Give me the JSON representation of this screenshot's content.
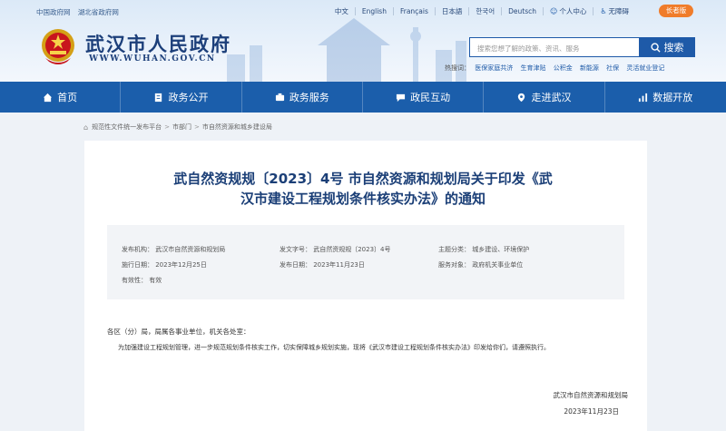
{
  "top": {
    "links": [
      "中国政府网",
      "湖北省政府网"
    ],
    "languages": [
      "中文",
      "English",
      "Français",
      "日本語",
      "한국어",
      "Deutsch"
    ],
    "personal": "个人中心",
    "accessible": "无障碍",
    "elder": "长者版"
  },
  "logo": {
    "title": "武汉市人民政府",
    "url": "WWW.WUHAN.GOV.CN"
  },
  "search": {
    "placeholder": "搜索您想了解的政策、资讯、服务",
    "button": "搜索",
    "hot_label": "热搜词：",
    "hot": [
      "医保家庭共济",
      "生育津贴",
      "公积金",
      "新能源",
      "社保",
      "灵活就业登记"
    ]
  },
  "nav": [
    {
      "label": "首页",
      "icon": "home-icon"
    },
    {
      "label": "政务公开",
      "icon": "doc-icon"
    },
    {
      "label": "政务服务",
      "icon": "service-icon"
    },
    {
      "label": "政民互动",
      "icon": "chat-icon"
    },
    {
      "label": "走进武汉",
      "icon": "location-icon"
    },
    {
      "label": "数据开放",
      "icon": "chart-icon"
    }
  ],
  "breadcrumb": [
    "规范性文件统一发布平台",
    "市部门",
    "市自然资源和城乡建设局"
  ],
  "doc": {
    "title_line1": "武自然资规规〔2023〕4号 市自然资源和规划局关于印发《武",
    "title_line2": "汉市建设工程规划条件核实办法》的通知",
    "meta": {
      "issuer": "发布机构：  武汉市自然资源和规划局",
      "doc_no": "发文字号：  武自然资规规〔2023〕4号",
      "category": "主题分类：  城乡建设、环境保护",
      "impl_date": "施行日期：  2023年12月25日",
      "pub_date": "发布日期：  2023年11月23日",
      "audience": "服务对象：  政府机关事业单位",
      "validity": "有效性：  有效"
    },
    "salutation": "各区（分）局，局属各事业单位，机关各处室：",
    "paragraph": "为加强建设工程规划管理，进一步规范规划条件核实工作，切实保障城乡规划实施，现将《武汉市建设工程规划条件核实办法》印发给你们，请遵照执行。",
    "signer": "武汉市自然资源和规划局",
    "sign_date": "2023年11月23日"
  }
}
